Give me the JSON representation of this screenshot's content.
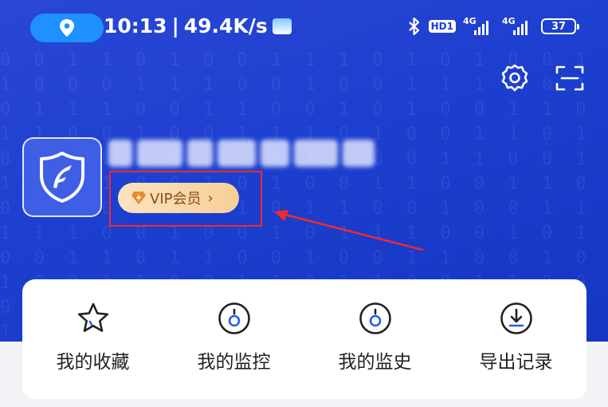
{
  "status_bar": {
    "time": "10:13",
    "separator": "|",
    "network_speed": "49.4K/s",
    "hd_badge": "HD1",
    "signal_1_label": "4G",
    "signal_2_label": "4G",
    "battery": "37",
    "icons": [
      "location-icon",
      "weather-icon",
      "bluetooth-icon",
      "signal-icon",
      "battery-icon"
    ]
  },
  "header": {
    "icons": [
      "settings-icon",
      "scan-icon"
    ]
  },
  "profile": {
    "username_visible_fragment": "1",
    "username_blurred": true,
    "vip_label": "VIP会员",
    "vip_chevron": "›",
    "vip_icon": "diamond-icon",
    "avatar_icon": "shield-logo-icon"
  },
  "annotation": {
    "box_color": "#ef2b2b",
    "arrow_color": "#ef2b2b"
  },
  "menu": {
    "items": [
      {
        "label": "我的收藏",
        "icon": "star-icon"
      },
      {
        "label": "我的监控",
        "icon": "monitor-icon"
      },
      {
        "label": "我的监史",
        "icon": "history-icon"
      },
      {
        "label": "导出记录",
        "icon": "download-icon"
      }
    ]
  },
  "colors": {
    "hero_blue": "#1d3fcf",
    "location_pill": "#1e90ff",
    "vip_text": "#8a4b16",
    "icon_stroke": "#222222",
    "icon_accent": "#2b5be8"
  }
}
